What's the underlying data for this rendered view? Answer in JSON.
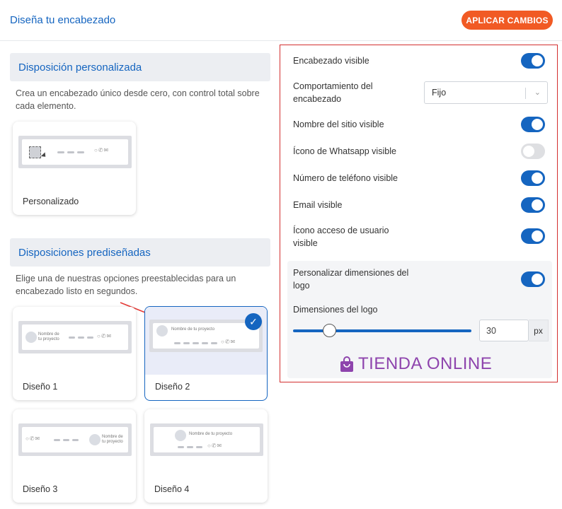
{
  "header": {
    "title": "Diseña tu encabezado",
    "apply_label": "APLICAR CAMBIOS"
  },
  "custom": {
    "heading": "Disposición personalizada",
    "description": "Crea un encabezado único desde cero, con control total sobre cada elemento.",
    "card_label": "Personalizado"
  },
  "predesigned": {
    "heading": "Disposiciones prediseñadas",
    "description": "Elige una de nuestras opciones preestablecidas para un encabezado listo en segundos.",
    "project_name": "Nombre de tu proyecto",
    "project_name_line1": "Nombre de",
    "project_name_line2": "tu proyecto",
    "cards": [
      {
        "label": "Diseño 1"
      },
      {
        "label": "Diseño 2"
      },
      {
        "label": "Diseño 3"
      },
      {
        "label": "Diseño 4"
      }
    ],
    "selected": "Diseño 2"
  },
  "settings": {
    "header_visible": {
      "label": "Encabezado visible",
      "on": true
    },
    "behavior": {
      "label": "Comportamiento del encabezado",
      "value": "Fijo"
    },
    "site_name_visible": {
      "label": "Nombre del sitio visible",
      "on": true
    },
    "whatsapp_visible": {
      "label": "Ícono de Whatsapp visible",
      "on": false
    },
    "phone_visible": {
      "label": "Número de teléfono visible",
      "on": true
    },
    "email_visible": {
      "label": "Email visible",
      "on": true
    },
    "user_access_visible": {
      "label": "Ícono acceso de usuario visible",
      "on": true
    },
    "custom_logo_size": {
      "label": "Personalizar dimensiones del logo",
      "on": true
    },
    "logo_size": {
      "label": "Dimensiones del logo",
      "value": "30",
      "unit": "px"
    },
    "brand_preview": "TIENDA ONLINE"
  },
  "colors": {
    "accent": "#1565c0",
    "apply_button": "#f15a24",
    "brand": "#8e44ad",
    "highlight_border": "#d32f2f"
  }
}
